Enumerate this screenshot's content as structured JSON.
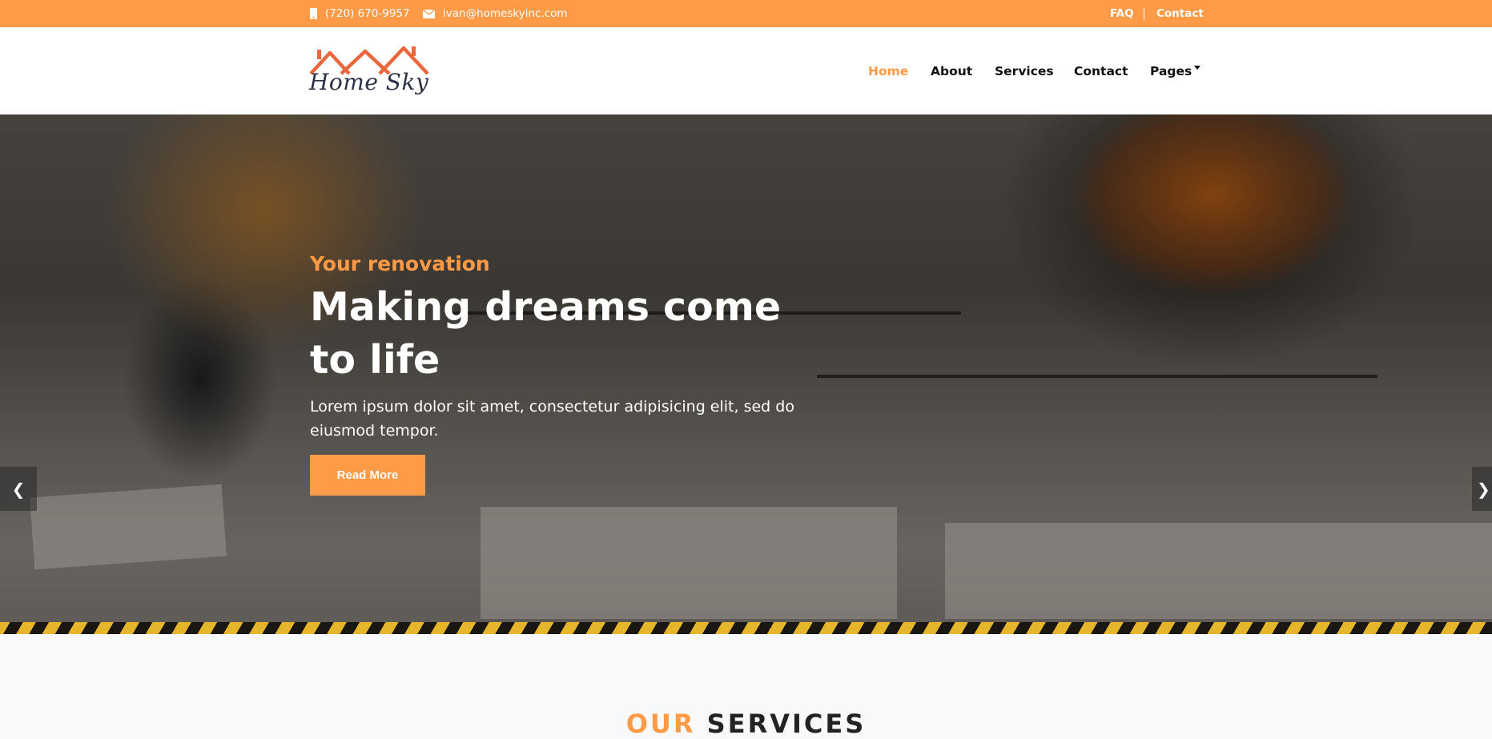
{
  "topbar": {
    "phone": "(720) 670-9957",
    "email": "ivan@homeskyinc.com",
    "links": {
      "faq": "FAQ",
      "contact": "Contact"
    }
  },
  "header": {
    "logo_text": "Home Sky",
    "nav": {
      "home": "Home",
      "about": "About",
      "services": "Services",
      "contact": "Contact",
      "pages": "Pages"
    },
    "active_item": "Home"
  },
  "hero": {
    "subtitle": "Your renovation",
    "title": "Making dreams come to life",
    "text": "Lorem ipsum dolor sit amet, consectetur adipisicing elit, sed do eiusmod tempor.",
    "button_label": "Read More",
    "prev_arrow": "❮",
    "next_arrow": "❯"
  },
  "services": {
    "title_accent": "OUR",
    "title_main": "SERVICES"
  },
  "colors": {
    "accent": "#ff9a46",
    "dark": "#111111",
    "hazard_yellow": "#e5b52b"
  },
  "icons": {
    "phone": "phone-icon",
    "email": "envelope-icon",
    "dropdown": "caret-down-icon"
  }
}
